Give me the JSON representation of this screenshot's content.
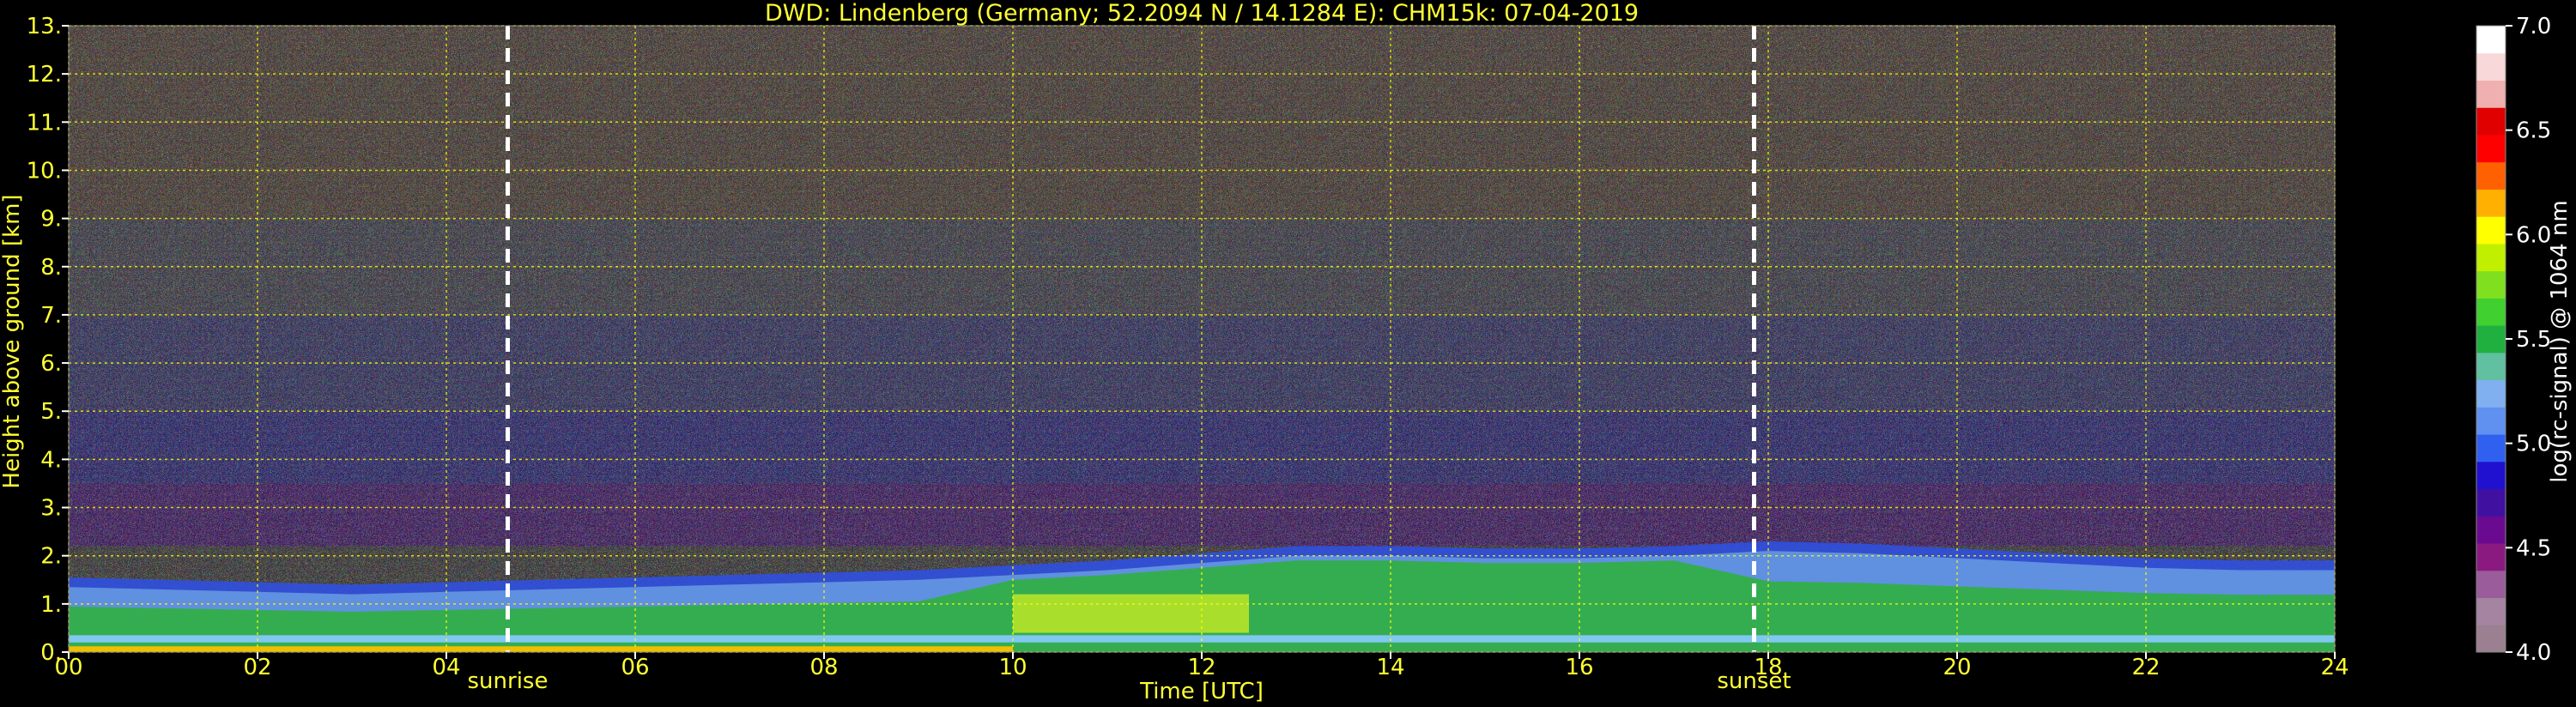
{
  "chart_data": {
    "type": "heatmap",
    "title": "DWD: Lindenberg (Germany; 52.2094 N / 14.1284 E):    CHM15k: 07-04-2019",
    "xlabel": "Time [UTC]",
    "ylabel": "Height above ground [km]",
    "xlim": [
      0,
      24
    ],
    "ylim": [
      0,
      13
    ],
    "x_ticks": [
      0,
      2,
      4,
      6,
      8,
      10,
      12,
      14,
      16,
      18,
      20,
      22,
      24
    ],
    "x_tick_labels": [
      "00",
      "02",
      "04",
      "06",
      "08",
      "10",
      "12",
      "14",
      "16",
      "18",
      "20",
      "22",
      "24"
    ],
    "y_ticks": [
      0,
      1,
      2,
      3,
      4,
      5,
      6,
      7,
      8,
      9,
      10,
      11,
      12,
      13
    ],
    "y_tick_labels": [
      "0.",
      "1.",
      "2.",
      "3.",
      "4.",
      "5.",
      "6.",
      "7.",
      "8.",
      "9.",
      "10.",
      "11.",
      "12.",
      "13."
    ],
    "grid": true,
    "annotations": [
      {
        "label": "sunrise",
        "x": 4.65
      },
      {
        "label": "sunset",
        "x": 17.85
      }
    ],
    "boundary_layer_top_km": [
      [
        0,
        1.35
      ],
      [
        1,
        1.3
      ],
      [
        2,
        1.25
      ],
      [
        3,
        1.2
      ],
      [
        4,
        1.25
      ],
      [
        5,
        1.3
      ],
      [
        6,
        1.35
      ],
      [
        7,
        1.4
      ],
      [
        8,
        1.45
      ],
      [
        9,
        1.5
      ],
      [
        10,
        1.6
      ],
      [
        11,
        1.7
      ],
      [
        12,
        1.85
      ],
      [
        13,
        2.0
      ],
      [
        14,
        2.0
      ],
      [
        15,
        1.95
      ],
      [
        16,
        1.95
      ],
      [
        17,
        2.0
      ],
      [
        18,
        2.1
      ],
      [
        19,
        2.05
      ],
      [
        20,
        1.95
      ],
      [
        21,
        1.85
      ],
      [
        22,
        1.75
      ],
      [
        23,
        1.7
      ],
      [
        24,
        1.7
      ]
    ],
    "colorbar": {
      "label": "log(rc-signal) @ 1064 nm",
      "range": [
        4.0,
        7.0
      ],
      "ticks": [
        4.0,
        4.5,
        5.0,
        5.5,
        6.0,
        6.5,
        7.0
      ],
      "tick_labels": [
        "4.0",
        "4.5",
        "5.0",
        "5.5",
        "6.0",
        "6.5",
        "7.0"
      ],
      "colors": [
        "#9a8090",
        "#a484a0",
        "#9a5c9a",
        "#8a1a80",
        "#6a0a90",
        "#4010a0",
        "#2010d0",
        "#3060f0",
        "#6090f0",
        "#80b0f0",
        "#60c0a0",
        "#20b040",
        "#40d030",
        "#80e020",
        "#c0f000",
        "#ffff00",
        "#ffb000",
        "#ff6000",
        "#ff0000",
        "#e00000",
        "#f0b0b0",
        "#f8d8d8",
        "#ffffff"
      ]
    }
  }
}
